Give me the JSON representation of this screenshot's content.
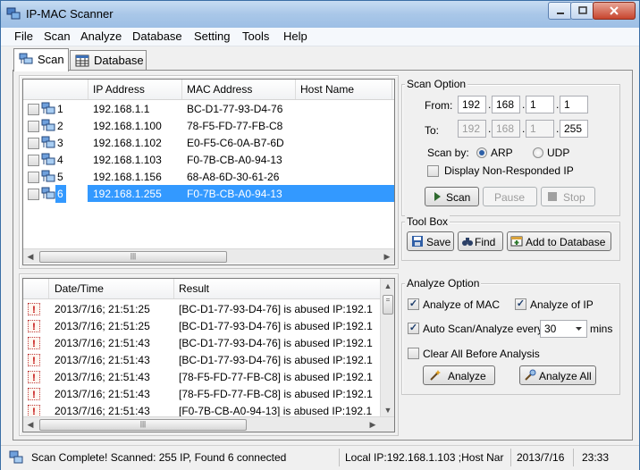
{
  "window": {
    "title": "IP-MAC Scanner",
    "min": "0",
    "max": "1",
    "close": "r"
  },
  "menu": [
    "File",
    "Scan",
    "Analyze",
    "Database",
    "Setting",
    "Tools",
    "Help"
  ],
  "tabs": [
    {
      "label": "Scan",
      "active": true
    },
    {
      "label": "Database",
      "active": false
    }
  ],
  "scan_table": {
    "columns": [
      "",
      "IP Address",
      "MAC Address",
      "Host Name"
    ],
    "rows": [
      {
        "num": "1",
        "ip": "192.168.1.1",
        "mac": "BC-D1-77-93-D4-76",
        "host": ""
      },
      {
        "num": "2",
        "ip": "192.168.1.100",
        "mac": "78-F5-FD-77-FB-C8",
        "host": ""
      },
      {
        "num": "3",
        "ip": "192.168.1.102",
        "mac": "E0-F5-C6-0A-B7-6D",
        "host": ""
      },
      {
        "num": "4",
        "ip": "192.168.1.103",
        "mac": "F0-7B-CB-A0-94-13",
        "host": ""
      },
      {
        "num": "5",
        "ip": "192.168.1.156",
        "mac": "68-A8-6D-30-61-26",
        "host": ""
      },
      {
        "num": "6",
        "ip": "192.168.1.255",
        "mac": "F0-7B-CB-A0-94-13",
        "host": ""
      }
    ],
    "selected_row": 6
  },
  "scan_option": {
    "title": "Scan Option",
    "from_label": "From:",
    "to_label": "To:",
    "from": [
      "192",
      "168",
      "1",
      "1"
    ],
    "to": [
      "192",
      "168",
      "1",
      "255"
    ],
    "scan_by_label": "Scan by:",
    "arp": "ARP",
    "udp": "UDP",
    "selected": "ARP",
    "display_label": "Display Non-Responded IP",
    "display_checked": false,
    "scan_btn": "Scan",
    "pause_btn": "Pause",
    "stop_btn": "Stop"
  },
  "toolbox": {
    "title": "Tool Box",
    "save": "Save",
    "find": "Find",
    "add": "Add to Database"
  },
  "log_table": {
    "columns": [
      "",
      "Date/Time",
      "Result"
    ],
    "rows": [
      {
        "time": "2013/7/16; 21:51:25",
        "result": "[BC-D1-77-93-D4-76] is abused IP:192.1"
      },
      {
        "time": "2013/7/16; 21:51:25",
        "result": "[BC-D1-77-93-D4-76] is abused IP:192.1"
      },
      {
        "time": "2013/7/16; 21:51:43",
        "result": "[BC-D1-77-93-D4-76] is abused IP:192.1"
      },
      {
        "time": "2013/7/16; 21:51:43",
        "result": "[BC-D1-77-93-D4-76] is abused IP:192.1"
      },
      {
        "time": "2013/7/16; 21:51:43",
        "result": "[78-F5-FD-77-FB-C8] is abused IP:192.1"
      },
      {
        "time": "2013/7/16; 21:51:43",
        "result": "[78-F5-FD-77-FB-C8] is abused IP:192.1"
      },
      {
        "time": "2013/7/16; 21:51:43",
        "result": "[F0-7B-CB-A0-94-13] is abused IP:192.1"
      }
    ]
  },
  "analyze_option": {
    "title": "Analyze Option",
    "of_mac": "Analyze of MAC",
    "of_ip": "Analyze of IP",
    "auto": "Auto Scan/Analyze every",
    "interval": "30",
    "mins": "mins",
    "clear": "Clear All Before Analysis",
    "checked_mac": true,
    "checked_ip": true,
    "checked_auto": true,
    "checked_clear": false,
    "analyze_btn": "Analyze",
    "analyze_all_btn": "Analyze All"
  },
  "status": {
    "message": "Scan Complete! Scanned: 255 IP, Found 6 connected",
    "local": "Local IP:192.168.1.103 ;Host Nar",
    "date": "2013/7/16",
    "time": "23:33"
  },
  "icons": {
    "app": "network-scanner-icon",
    "computer": "computer-network-icon",
    "warning": "warning-icon"
  }
}
